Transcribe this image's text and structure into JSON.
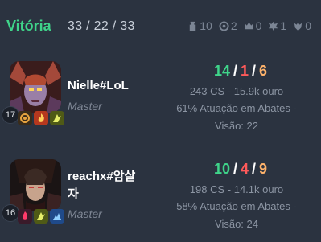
{
  "header": {
    "result": "Vitória",
    "team_score": "33 / 22 / 33",
    "objectives": [
      {
        "icon": "tower-icon",
        "count": "10"
      },
      {
        "icon": "inhibitor-icon",
        "count": "2"
      },
      {
        "icon": "baron-icon",
        "count": "0"
      },
      {
        "icon": "dragon-icon",
        "count": "1"
      },
      {
        "icon": "herald-icon",
        "count": "0"
      }
    ]
  },
  "players": [
    {
      "name": "Nielle#LoL",
      "rank": "Master",
      "level": "17",
      "kills": "14",
      "deaths": "1",
      "assists": "6",
      "cs_line": "243 CS - 15.9k ouro",
      "participation_line": "61% Atuação em Abates -",
      "vision_line": "Visão: 22",
      "spells": [
        "ignite-icon",
        "flash-icon",
        "rune-icon"
      ]
    },
    {
      "name_line1": "reachx#암살",
      "name_line2": "자",
      "rank": "Master",
      "level": "16",
      "kills": "10",
      "deaths": "4",
      "assists": "9",
      "cs_line": "198 CS - 14.1k ouro",
      "participation_line": "58% Atuação em Abates -",
      "vision_line": "Visão: 24",
      "spells": [
        "flash-icon",
        "rune-icon",
        "ghost-icon"
      ]
    }
  ],
  "colors": {
    "background": "#2b3340",
    "victory_green": "#3fd58a",
    "kills": "#3fd58a",
    "deaths": "#ff5a5a",
    "assists": "#ffb36b"
  }
}
